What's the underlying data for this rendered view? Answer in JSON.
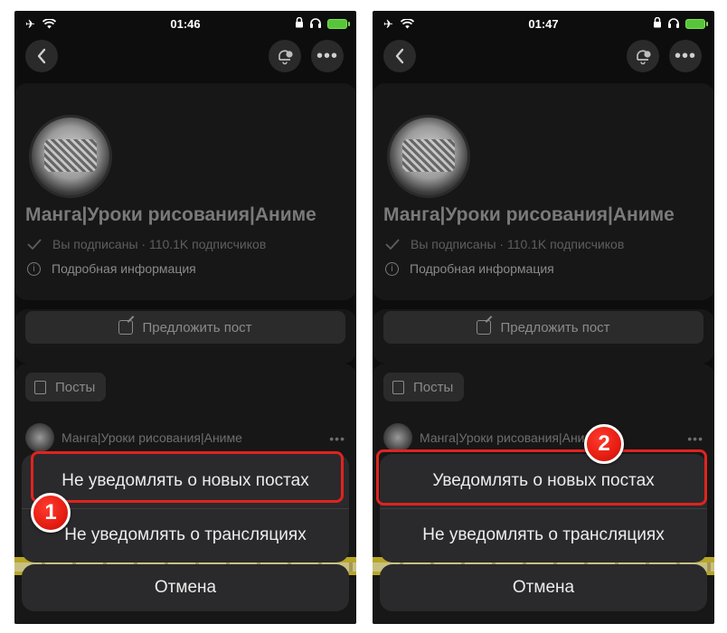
{
  "screens": [
    {
      "status": {
        "time": "01:46"
      },
      "group": {
        "name": "Манга|Уроки рисования|Аниме",
        "subscription": "Вы подписаны · 110.1K подписчиков",
        "info_label": "Подробная информация"
      },
      "suggest_label": "Предложить пост",
      "posts_label": "Посты",
      "post_author": "Манга|Уроки рисования|Аниме",
      "action_sheet": {
        "items": [
          "Не уведомлять о новых постах",
          "Не уведомлять о трансляциях"
        ],
        "cancel": "Отмена"
      },
      "step": "1"
    },
    {
      "status": {
        "time": "01:47"
      },
      "group": {
        "name": "Манга|Уроки рисования|Аниме",
        "subscription": "Вы подписаны · 110.1K подписчиков",
        "info_label": "Подробная информация"
      },
      "suggest_label": "Предложить пост",
      "posts_label": "Посты",
      "post_author": "Манга|Уроки рисования|Аниме",
      "action_sheet": {
        "items": [
          "Уведомлять о новых постах",
          "Не уведомлять о трансляциях"
        ],
        "cancel": "Отмена"
      },
      "step": "2"
    }
  ],
  "colors": {
    "accent": "#e0231f",
    "background": "#0d0d0d",
    "sheet": "#2a2a2c"
  },
  "icons": [
    "airplane-icon",
    "wifi-icon",
    "headphones-icon",
    "battery-icon",
    "back-icon",
    "bell-check-icon",
    "more-icon",
    "checkmark-icon",
    "info-icon",
    "edit-icon",
    "document-icon"
  ]
}
